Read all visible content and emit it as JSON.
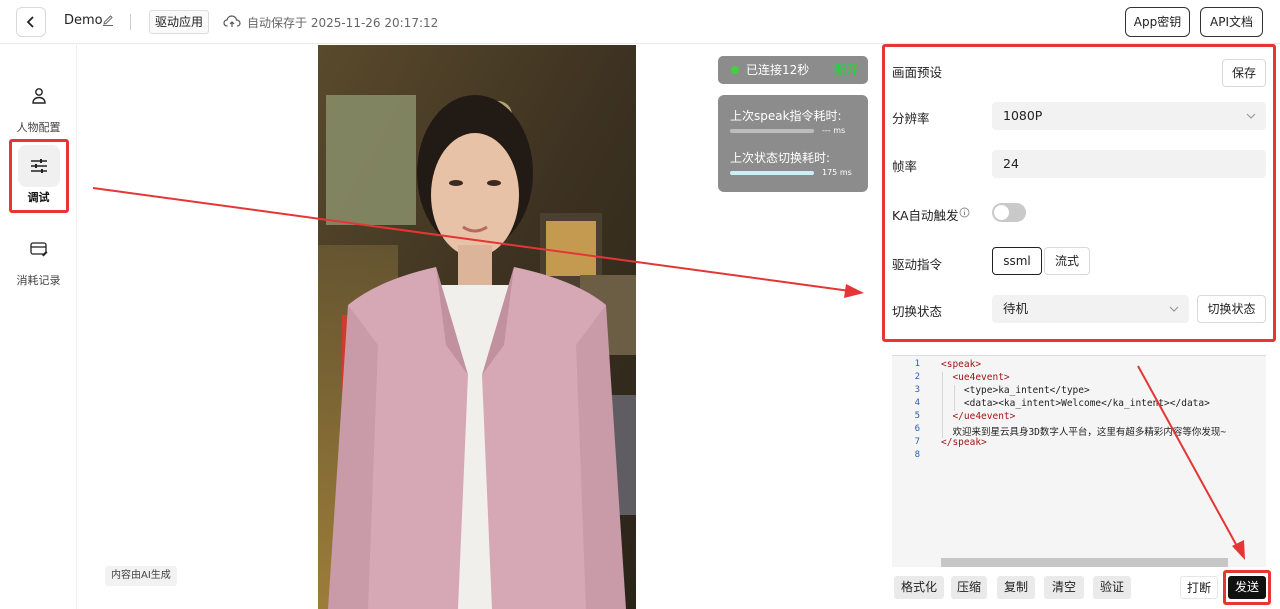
{
  "header": {
    "title": "Demo",
    "tag": "驱动应用",
    "autosave": "自动保存于 2025-11-26 20:17:12",
    "app_key_button": "App密钥",
    "api_doc_button": "API文档"
  },
  "sidebar": {
    "items": [
      {
        "label": "人物配置",
        "icon": "person-icon"
      },
      {
        "label": "调试",
        "icon": "sliders-icon"
      },
      {
        "label": "消耗记录",
        "icon": "card-icon"
      }
    ]
  },
  "stage": {
    "ai_note": "内容由AI生成",
    "status": {
      "text": "已连接12秒",
      "disconnect": "断开"
    },
    "stats": {
      "speak_label": "上次speak指令耗时:",
      "speak_value": "--- ms",
      "switch_label": "上次状态切换耗时:",
      "switch_value": "175 ms"
    }
  },
  "panel": {
    "preset_label": "画面预设",
    "save_button": "保存",
    "resolution_label": "分辨率",
    "resolution_value": "1080P",
    "framerate_label": "帧率",
    "framerate_value": "24",
    "ka_label": "KA自动触发",
    "drive_label": "驱动指令",
    "drive_options": [
      "ssml",
      "流式"
    ],
    "switch_label": "切换状态",
    "switch_value": "待机",
    "switch_button": "切换状态"
  },
  "editor": {
    "line_numbers": [
      "1",
      "2",
      "3",
      "4",
      "5",
      "6",
      "7",
      "8"
    ],
    "lines": [
      "<speak>",
      "  <ue4event>",
      "    <type>ka_intent</type>",
      "    <data><ka_intent>Welcome</ka_intent></data>",
      "  </ue4event>",
      "  欢迎来到星云具身3D数字人平台，这里有超多精彩内容等你发现~",
      "</speak>",
      ""
    ]
  },
  "actions": {
    "format": "格式化",
    "compress": "压缩",
    "copy": "复制",
    "clear": "清空",
    "validate": "验证",
    "interrupt": "打断",
    "send": "发送"
  },
  "colors": {
    "accent": "#222222",
    "highlight": "#e53535",
    "connected": "#3fd23f"
  }
}
